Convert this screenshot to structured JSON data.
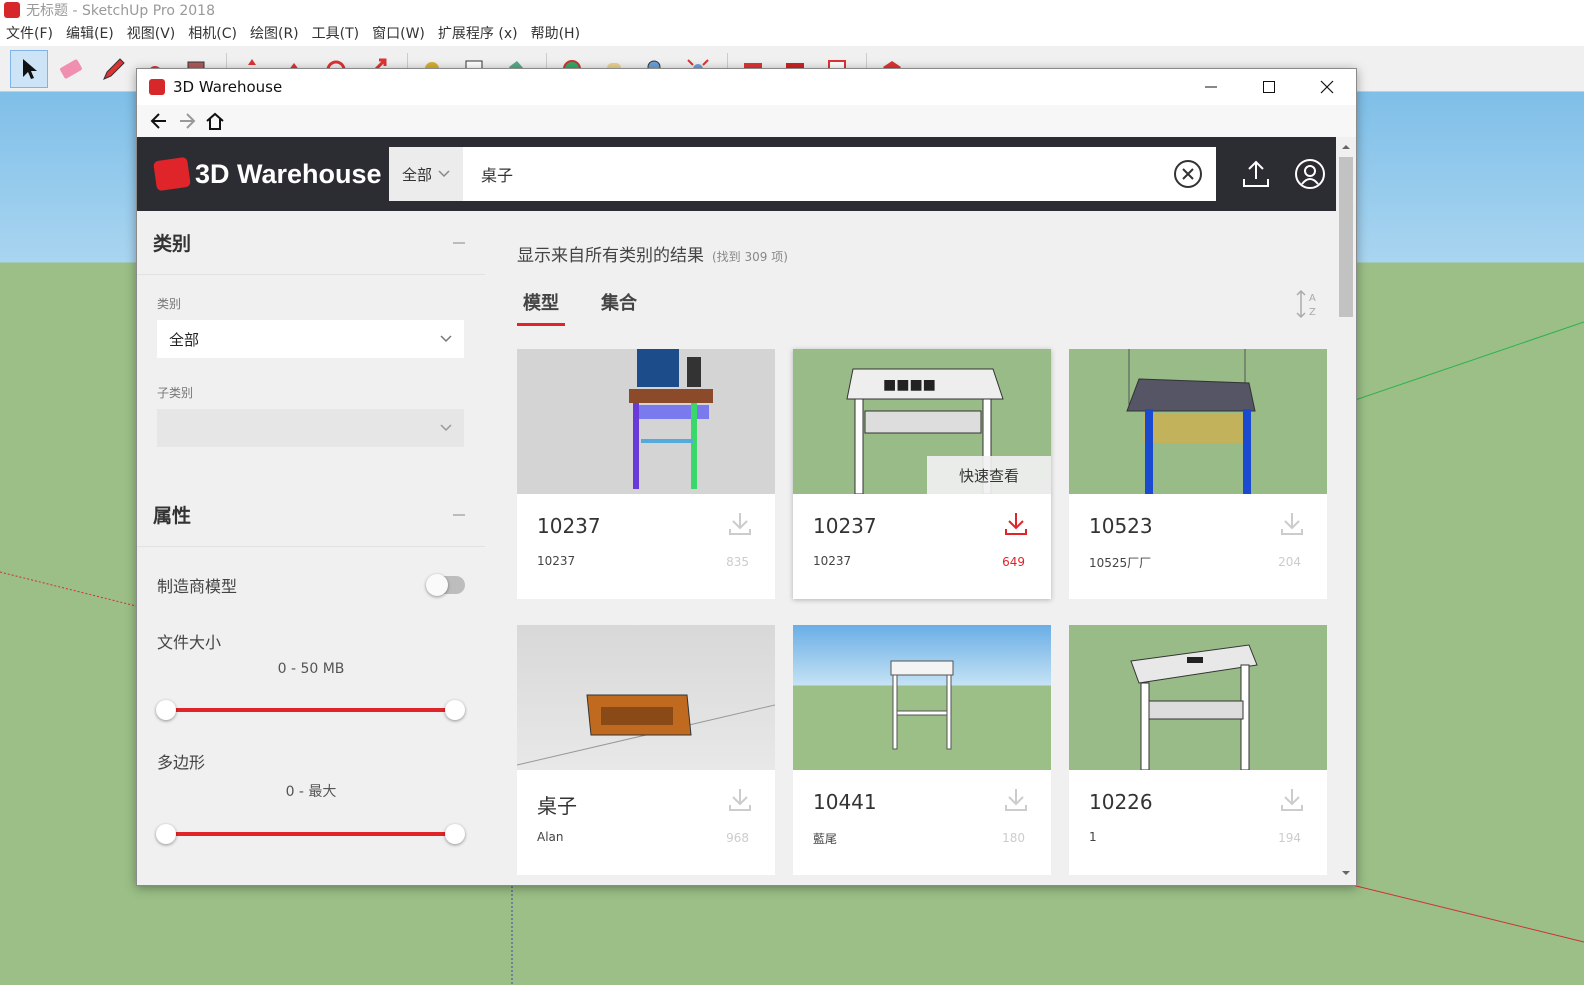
{
  "host": {
    "title": "无标题 - SketchUp Pro 2018",
    "menu": [
      "文件(F)",
      "编辑(E)",
      "视图(V)",
      "相机(C)",
      "绘图(R)",
      "工具(T)",
      "窗口(W)",
      "扩展程序 (x)",
      "帮助(H)"
    ]
  },
  "dialog": {
    "title": "3D Warehouse",
    "brand": "3D Warehouse",
    "search": {
      "scope": "全部",
      "query": "桌子"
    },
    "sidebar": {
      "category_header": "类别",
      "category_label": "类别",
      "category_value": "全部",
      "subcategory_label": "子类别",
      "attributes_header": "属性",
      "manufacturer_label": "制造商模型",
      "filesize_label": "文件大小",
      "filesize_range": "0 - 50 MB",
      "polygons_label": "多边形",
      "polygons_range": "0 - 最大"
    },
    "results_text": "显示来自所有类别的结果",
    "results_count": "(找到 309 项)",
    "tabs": [
      "模型",
      "集合"
    ],
    "quick_view": "快速查看",
    "cards": [
      {
        "name": "10237",
        "author": "10237",
        "downloads": "835"
      },
      {
        "name": "10237",
        "author": "10237",
        "downloads": "649"
      },
      {
        "name": "10523",
        "author": "10525厂厂",
        "downloads": "204"
      },
      {
        "name": "桌子",
        "author": "Alan",
        "downloads": "968"
      },
      {
        "name": "10441",
        "author": "藍尾",
        "downloads": "180"
      },
      {
        "name": "10226",
        "author": "1",
        "downloads": "194"
      }
    ]
  },
  "colors": {
    "accent": "#e0252a",
    "header": "#2c2c33"
  }
}
